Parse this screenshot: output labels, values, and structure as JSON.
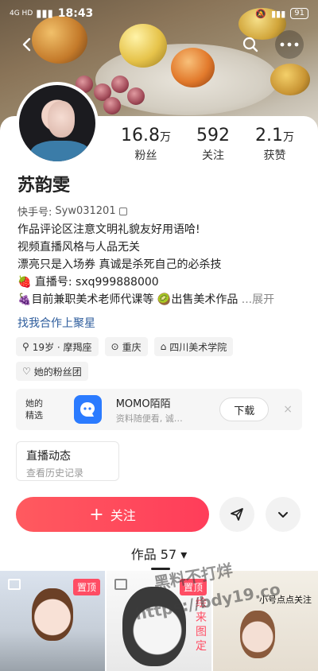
{
  "status": {
    "network": "4G HD",
    "time": "18:43",
    "battery": "91"
  },
  "profile": {
    "name": "苏韵雯",
    "kuaishou_id_label": "快手号:",
    "kuaishou_id": "Syw031201",
    "stats": [
      {
        "num": "16.8",
        "unit": "万",
        "label": "粉丝"
      },
      {
        "num": "592",
        "unit": "",
        "label": "关注"
      },
      {
        "num": "2.1",
        "unit": "万",
        "label": "获赞"
      }
    ],
    "bio": {
      "line1": "作品评论区注意文明礼貌友好用语哈!",
      "line2": "视频直播风格与人品无关",
      "line3": "漂亮只是入场券 真诚是杀死自己的必杀技",
      "line4_prefix": "🍓",
      "line4": "直播号: sxq999888000",
      "line5_prefix": "🍇",
      "line5_a": "目前兼职美术老师代课等",
      "line5_mid": "🥝",
      "line5_b": "出售美术作品",
      "line5_more": "...展开"
    },
    "partner_link": "找我合作上聚星",
    "tags": [
      {
        "icon": "pin-icon",
        "text": "19岁 · 摩羯座"
      },
      {
        "icon": "location-icon",
        "text": "重庆"
      },
      {
        "icon": "school-icon",
        "text": "四川美术学院"
      }
    ],
    "fan_group": "她的粉丝团"
  },
  "promo": {
    "tag_line1": "她的",
    "tag_line2": "精选",
    "app_name": "MOMO陌陌",
    "app_desc": "资料随便看, 诚…",
    "download": "下载",
    "close": "×"
  },
  "live_card": {
    "title": "直播动态",
    "subtitle": "查看历史记录"
  },
  "actions": {
    "follow": "关注",
    "follow_plus": "+"
  },
  "works": {
    "label": "作品 57",
    "caret": "▾"
  },
  "grid": [
    {
      "pinned": "置顶"
    },
    {
      "pinned": "置顶",
      "side_text": "绘来图定"
    },
    {
      "caption": "小号点点关注"
    }
  ],
  "watermark": {
    "line1": "黑料不打烊",
    "line2": "https://bdy19.co"
  }
}
